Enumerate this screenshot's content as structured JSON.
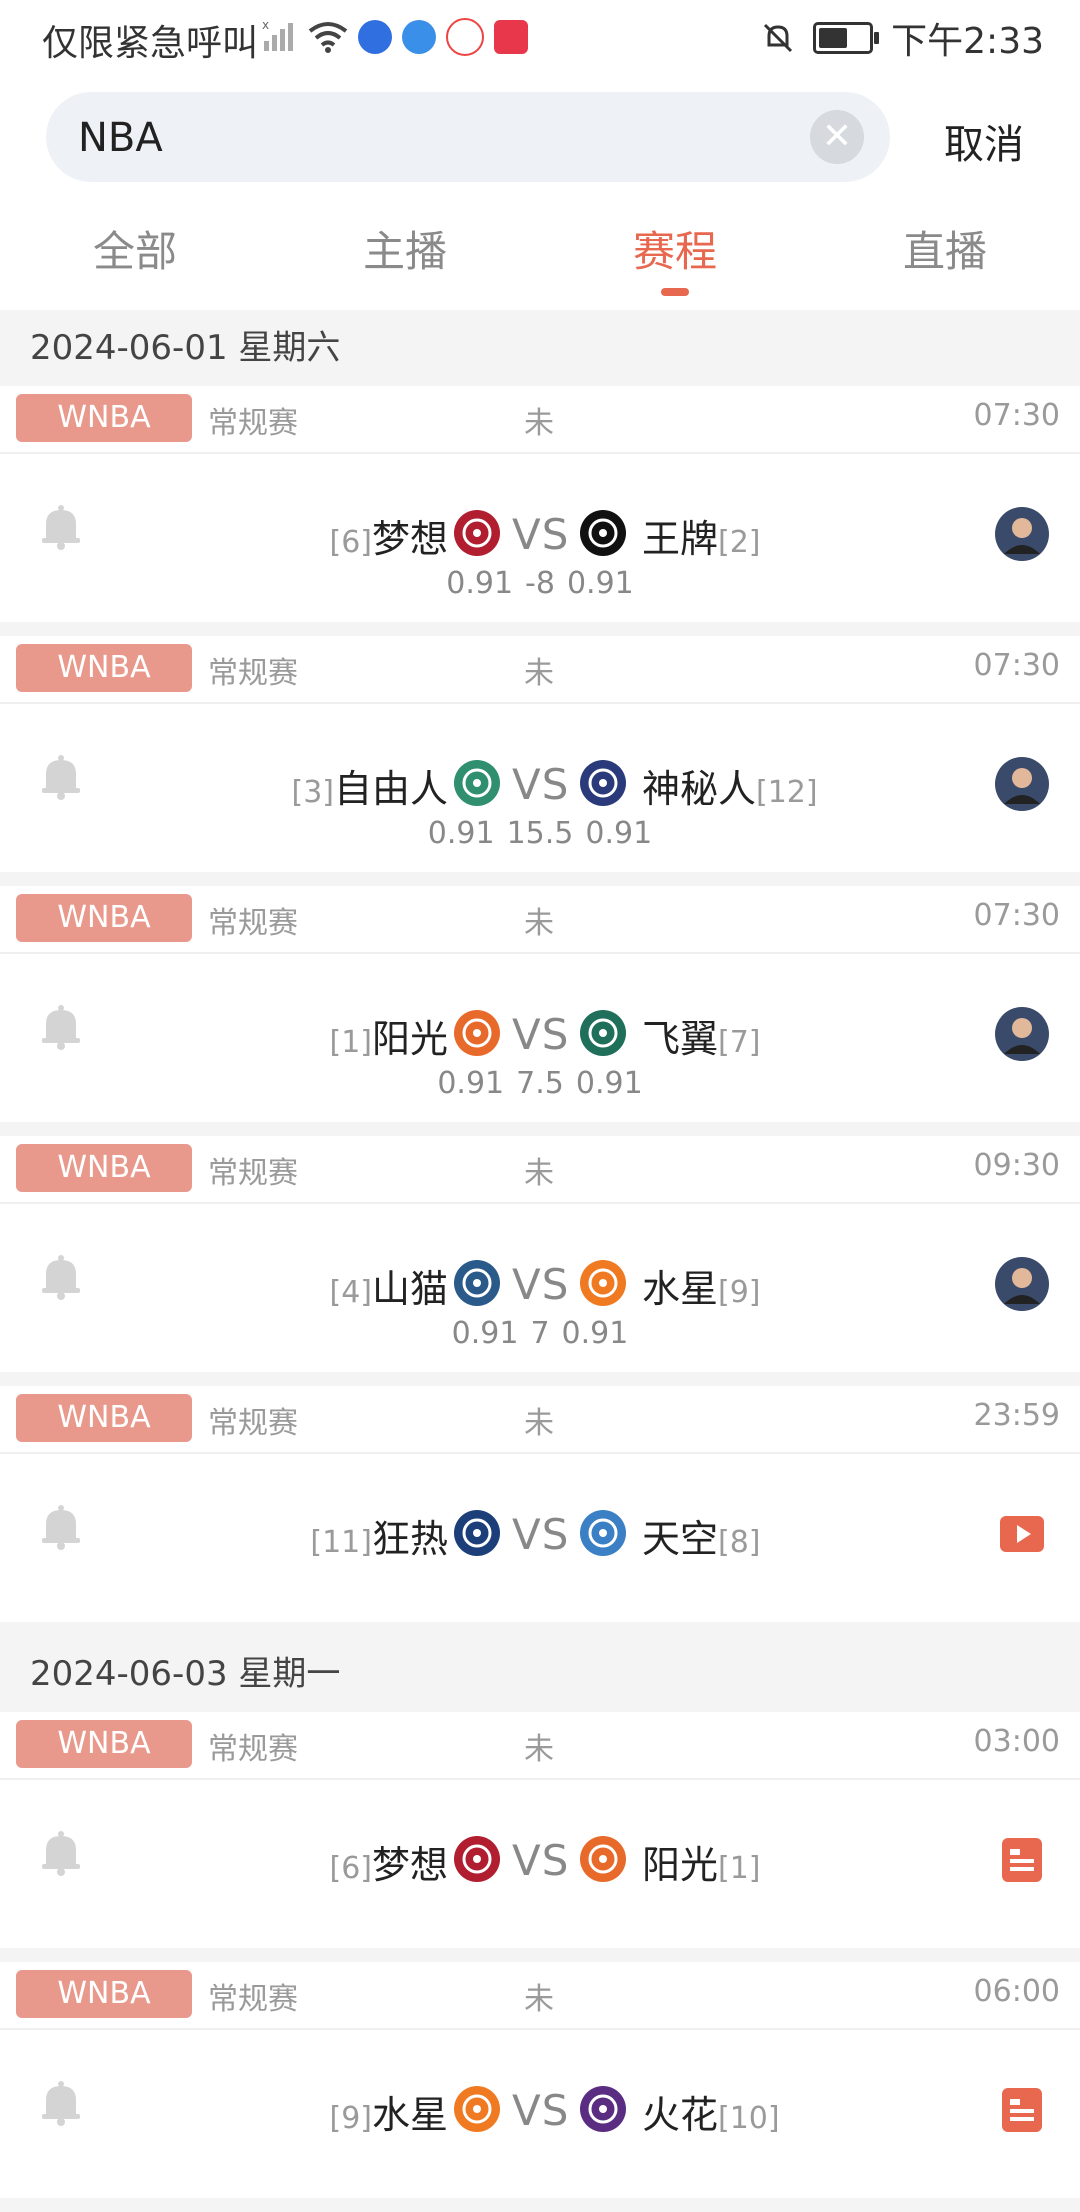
{
  "status_bar": {
    "carrier": "仅限紧急呼叫",
    "time": "下午2:33"
  },
  "search": {
    "value": "NBA",
    "cancel_label": "取消"
  },
  "tabs": [
    {
      "label": "全部",
      "active": false
    },
    {
      "label": "主播",
      "active": false
    },
    {
      "label": "赛程",
      "active": true
    },
    {
      "label": "直播",
      "active": false
    }
  ],
  "days": [
    {
      "date": "2024-06-01  星期六",
      "matches": [
        {
          "league": "WNBA",
          "round": "常规赛",
          "state": "未",
          "time": "07:30",
          "home_rank": "[6]",
          "home": "梦想",
          "away": "王牌",
          "away_rank": "[2]",
          "odds": [
            "0.91",
            "-8",
            "0.91"
          ],
          "action": "avatar",
          "home_logo_color": "#b01e2f",
          "away_logo_color": "#111111"
        },
        {
          "league": "WNBA",
          "round": "常规赛",
          "state": "未",
          "time": "07:30",
          "home_rank": "[3]",
          "home": "自由人",
          "away": "神秘人",
          "away_rank": "[12]",
          "odds": [
            "0.91",
            "15.5",
            "0.91"
          ],
          "action": "avatar",
          "home_logo_color": "#2f8f6f",
          "away_logo_color": "#2b3a7a"
        },
        {
          "league": "WNBA",
          "round": "常规赛",
          "state": "未",
          "time": "07:30",
          "home_rank": "[1]",
          "home": "阳光",
          "away": "飞翼",
          "away_rank": "[7]",
          "odds": [
            "0.91",
            "7.5",
            "0.91"
          ],
          "action": "avatar",
          "home_logo_color": "#e86a2b",
          "away_logo_color": "#1f6f5a"
        },
        {
          "league": "WNBA",
          "round": "常规赛",
          "state": "未",
          "time": "09:30",
          "home_rank": "[4]",
          "home": "山猫",
          "away": "水星",
          "away_rank": "[9]",
          "odds": [
            "0.91",
            "7",
            "0.91"
          ],
          "action": "avatar",
          "home_logo_color": "#2a5a8a",
          "away_logo_color": "#f07a22"
        },
        {
          "league": "WNBA",
          "round": "常规赛",
          "state": "未",
          "time": "23:59",
          "home_rank": "[11]",
          "home": "狂热",
          "away": "天空",
          "away_rank": "[8]",
          "odds": [],
          "action": "play",
          "home_logo_color": "#1c3f7a",
          "away_logo_color": "#3b7fc4"
        }
      ]
    },
    {
      "date": "2024-06-03  星期一",
      "matches": [
        {
          "league": "WNBA",
          "round": "常规赛",
          "state": "未",
          "time": "03:00",
          "home_rank": "[6]",
          "home": "梦想",
          "away": "阳光",
          "away_rank": "[1]",
          "odds": [],
          "action": "doc",
          "home_logo_color": "#b01e2f",
          "away_logo_color": "#e86a2b"
        },
        {
          "league": "WNBA",
          "round": "常规赛",
          "state": "未",
          "time": "06:00",
          "home_rank": "[9]",
          "home": "水星",
          "away": "火花",
          "away_rank": "[10]",
          "odds": [],
          "action": "doc",
          "home_logo_color": "#f07a22",
          "away_logo_color": "#5a2d82"
        }
      ]
    }
  ],
  "colors": {
    "accent": "#e8674f",
    "badge": "#e8998c",
    "muted": "#9a9a9a"
  }
}
